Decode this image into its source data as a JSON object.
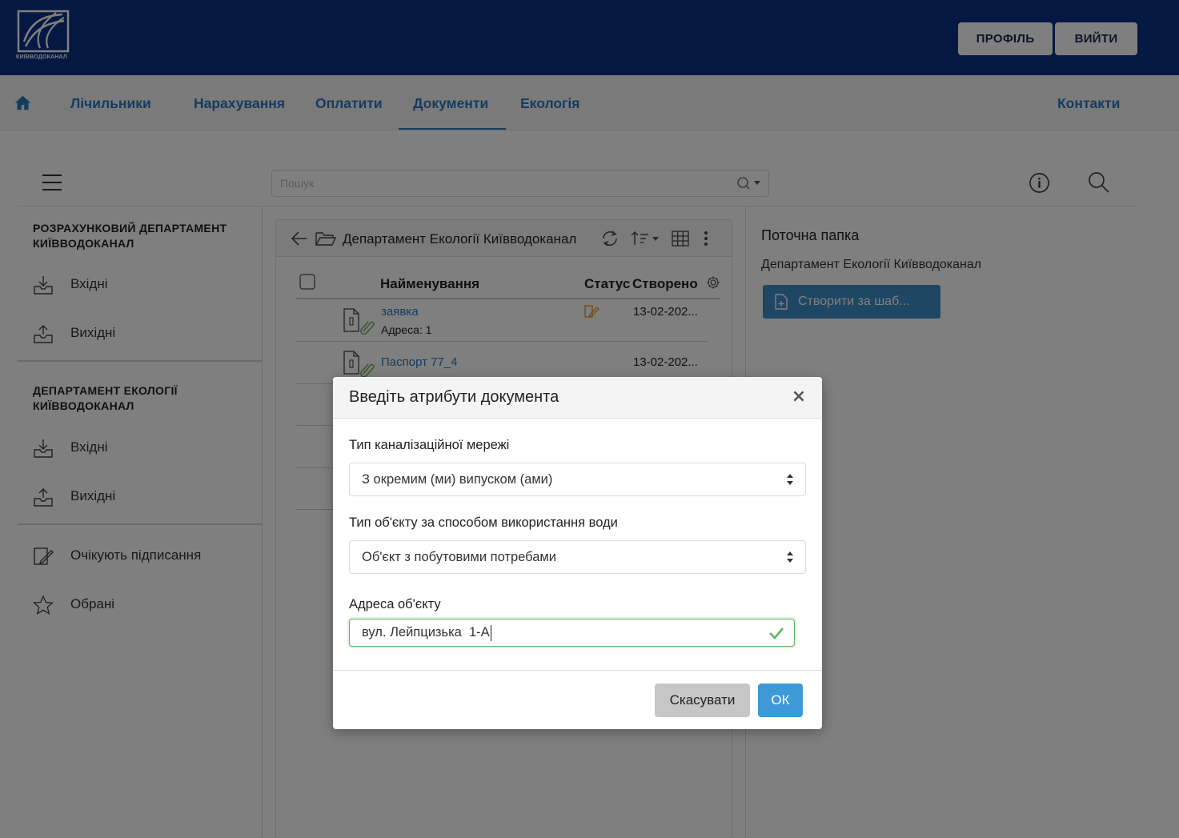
{
  "header": {
    "logo_text": "КИЇВВОДОКАНАЛ",
    "profile_label": "ПРОФІЛЬ",
    "logout_label": "ВИЙТИ"
  },
  "nav": {
    "items": [
      "Лічильники",
      "Нарахування",
      "Оплатити",
      "Документи",
      "Екологія"
    ],
    "active": "Документи",
    "contacts": "Контакти"
  },
  "toolbar": {
    "search_placeholder": "Пошук"
  },
  "sidebar": {
    "sections": [
      {
        "title": "РОЗРАХУНКОВИЙ ДЕПАРТАМЕНТ КИЇВВОДОКАНАЛ",
        "items": [
          "Вхідні",
          "Вихідні"
        ]
      },
      {
        "title": "ДЕПАРТАМЕНТ ЕКОЛОГІЇ КИЇВВОДОКАНАЛ",
        "items": [
          "Вхідні",
          "Вихідні"
        ]
      }
    ],
    "extra_items": [
      "Очікують підписання",
      "Обрані"
    ]
  },
  "folder": {
    "title": "Департамент Екології Київводоканал",
    "columns": [
      "Найменування",
      "Статус",
      "Створено"
    ],
    "rows": [
      {
        "name": "заявка",
        "sub": "Адреса: 1",
        "date": "13-02-202..."
      },
      {
        "name": "Паспорт 77_4",
        "sub": "",
        "date": "13-02-202..."
      }
    ]
  },
  "right_panel": {
    "title": "Поточна папка",
    "folder_name": "Департамент Екології Київводоканал",
    "create_button": "Створити за шаб..."
  },
  "modal": {
    "title": "Введіть атрибути документа",
    "close_glyph": "×",
    "fields": [
      {
        "label": "Тип каналізаційної мережі",
        "value": "З окремим (ми) випуском (ами)"
      },
      {
        "label": "Тип об'єкту за способом використання води",
        "value": "Об'єкт з побутовими потребами"
      },
      {
        "label": "Адреса об'єкту",
        "value": "вул. Лейпцизька  1-А"
      }
    ],
    "cancel_label": "Скасувати",
    "ok_label": "ОК"
  },
  "colors": {
    "header_bg": "#0a3184",
    "link": "#2b78c0",
    "primary_button": "#3d9ad6",
    "valid_border": "#5cb85c",
    "status_icon": "#e8a23a",
    "attachment_icon": "#6aa84f"
  }
}
